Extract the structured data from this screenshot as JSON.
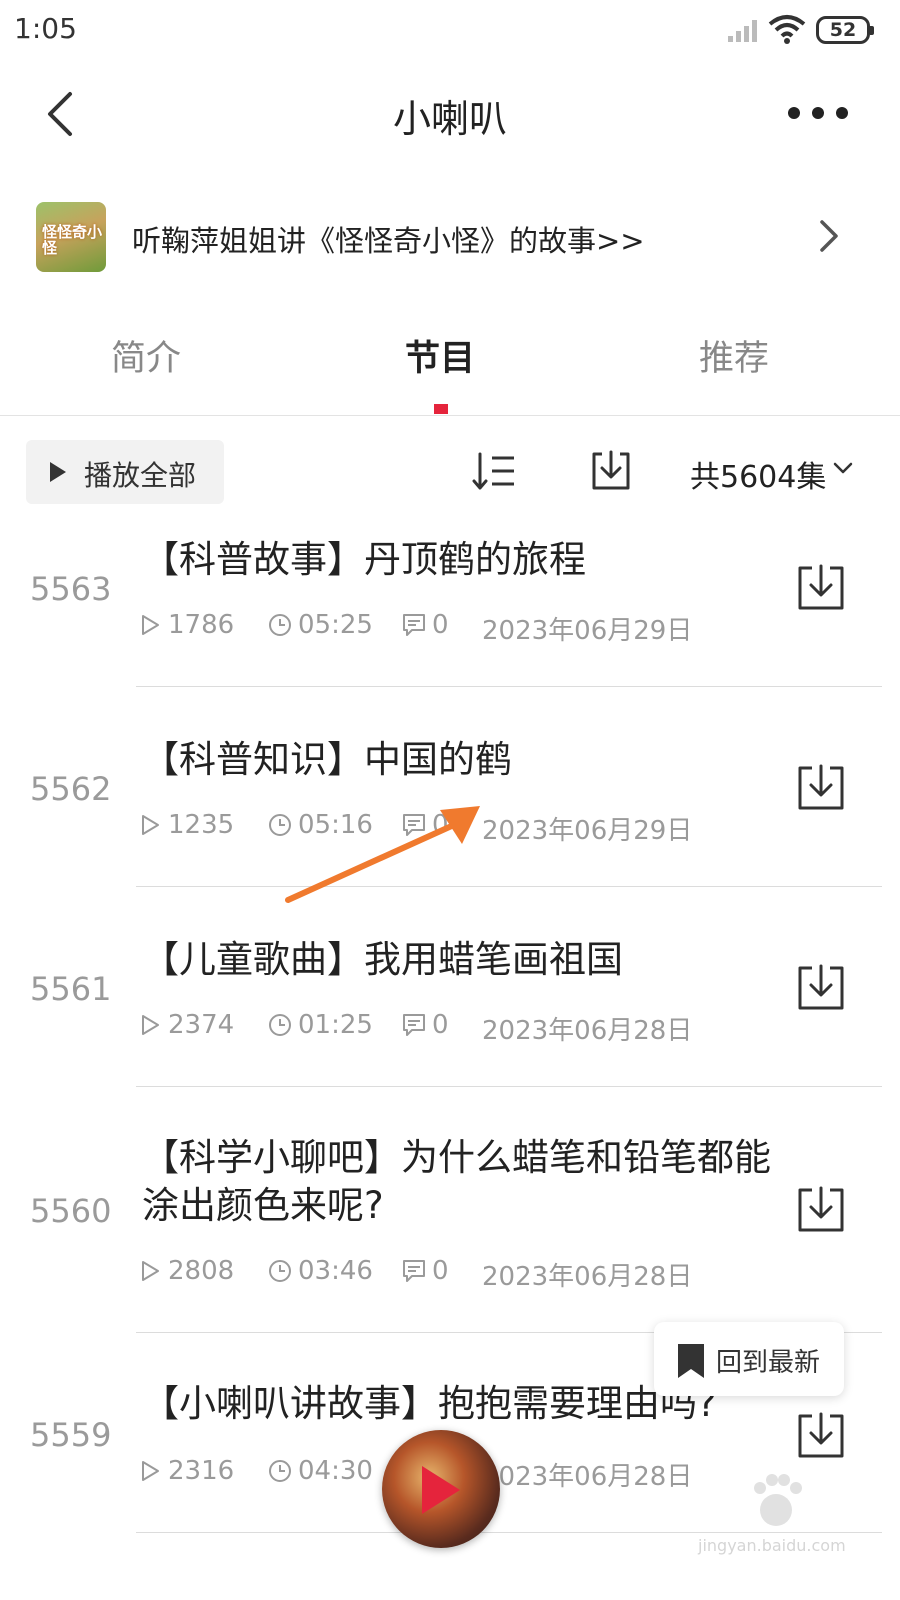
{
  "status_bar": {
    "time": "1:05",
    "battery": "52"
  },
  "nav": {
    "title": "小喇叭"
  },
  "album_banner": {
    "thumb_text": "怪怪奇小怪",
    "text": "听鞠萍姐姐讲《怪怪奇小怪》的故事>>"
  },
  "tabs": [
    {
      "label": "简介",
      "active": false
    },
    {
      "label": "节目",
      "active": true
    },
    {
      "label": "推荐",
      "active": false
    }
  ],
  "toolbar": {
    "play_all_label": "播放全部",
    "episode_count": "共5604集"
  },
  "episodes": [
    {
      "number": "5563",
      "title": "【科普故事】丹顶鹤的旅程",
      "plays": "1786",
      "duration": "05:25",
      "comments": "0",
      "date": "2023年06月29日"
    },
    {
      "number": "5562",
      "title": "【科普知识】中国的鹤",
      "plays": "1235",
      "duration": "05:16",
      "comments": "0",
      "date": "2023年06月29日"
    },
    {
      "number": "5561",
      "title": "【儿童歌曲】我用蜡笔画祖国",
      "plays": "2374",
      "duration": "01:25",
      "comments": "0",
      "date": "2023年06月28日"
    },
    {
      "number": "5560",
      "title": "【科学小聊吧】为什么蜡笔和铅笔都能涂出颜色来呢?",
      "plays": "2808",
      "duration": "03:46",
      "comments": "0",
      "date": "2023年06月28日"
    },
    {
      "number": "5559",
      "title": "【小喇叭讲故事】抱抱需要理由吗?",
      "plays": "2316",
      "duration": "04:30",
      "comments": "",
      "date": "2023年06月28日"
    }
  ],
  "back_to_latest": {
    "label": "回到最新"
  },
  "watermark": {
    "text": "jingyan.baidu.com"
  },
  "colors": {
    "accent": "#e5243c",
    "annotation_arrow": "#f07a2e"
  }
}
